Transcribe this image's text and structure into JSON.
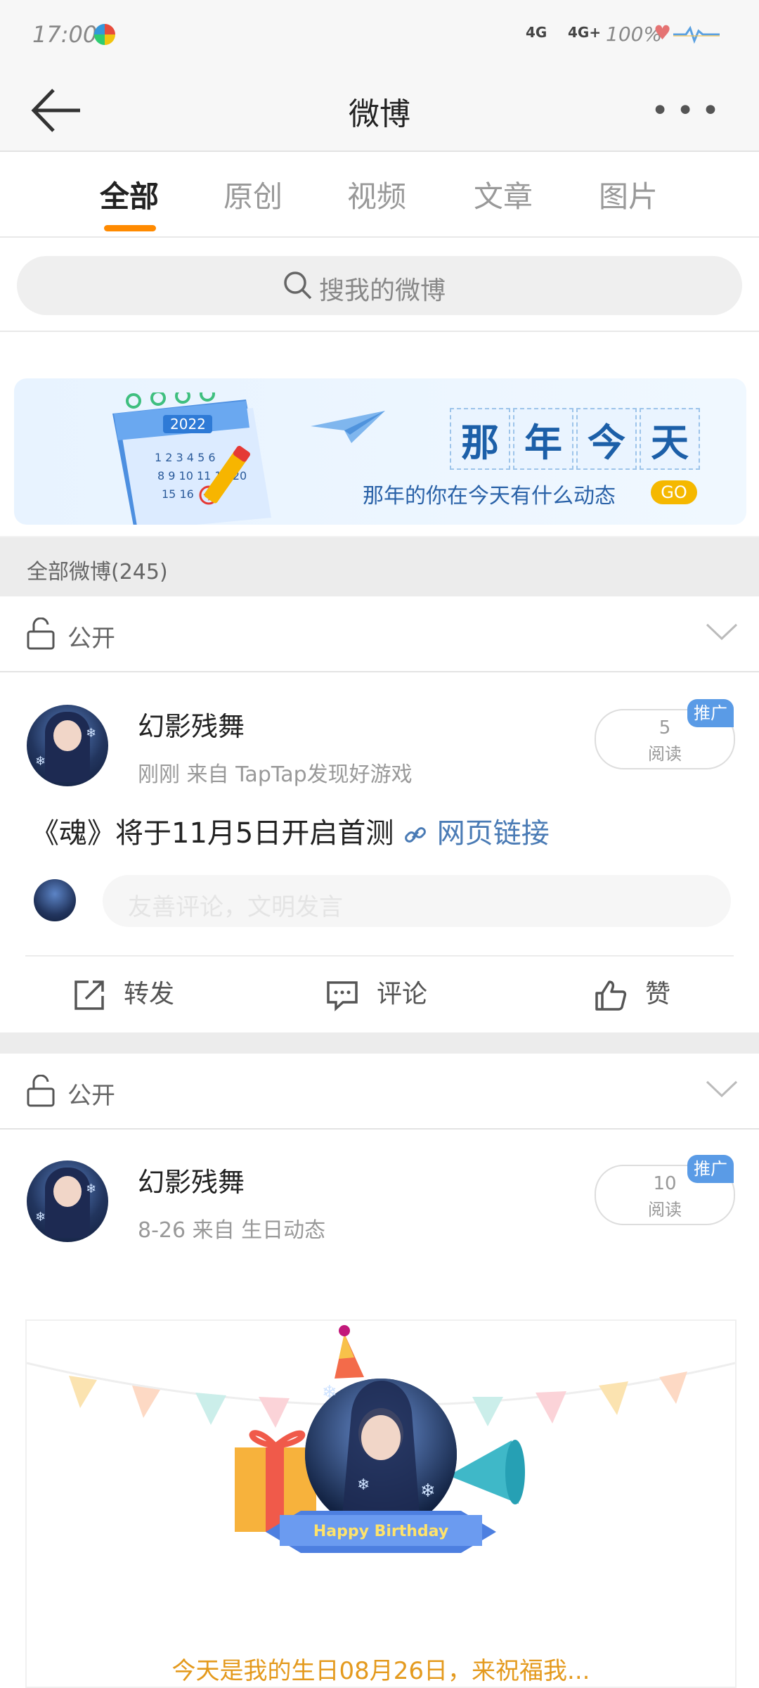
{
  "status_bar": {
    "time": "17:00",
    "signal1": "4G",
    "signal2": "4G+",
    "battery": "100%"
  },
  "header": {
    "title": "微博"
  },
  "tabs": [
    {
      "label": "全部",
      "active": true
    },
    {
      "label": "原创",
      "active": false
    },
    {
      "label": "视频",
      "active": false
    },
    {
      "label": "文章",
      "active": false
    },
    {
      "label": "图片",
      "active": false
    }
  ],
  "search": {
    "placeholder": "搜我的微博"
  },
  "banner": {
    "calendar_year": "2022",
    "calendar_today": "今",
    "title_chars": [
      "那",
      "年",
      "今",
      "天"
    ],
    "subtitle": "那年的你在今天有什么动态",
    "go": "GO"
  },
  "count_bar": {
    "label": "全部微博(245)"
  },
  "posts": [
    {
      "visibility": "公开",
      "username": "幻影残舞",
      "meta": "刚刚  来自  TapTap发现好游戏",
      "reads": "5",
      "reads_label": "阅读",
      "promo": "推广",
      "content": "《魂》将于11月5日开启首测",
      "link_text": "网页链接",
      "comment_placeholder": "友善评论，文明发言",
      "actions": {
        "repost": "转发",
        "comment": "评论",
        "like": "赞"
      }
    },
    {
      "visibility": "公开",
      "username": "幻影残舞",
      "meta": "8-26  来自  生日动态",
      "reads": "10",
      "reads_label": "阅读",
      "promo": "推广",
      "card_badge": "Happy Birthday",
      "card_text": "今天是我的生日08月26日，来祝福我..."
    }
  ],
  "colors": {
    "accent": "#ff8a00",
    "promo": "#5a9be6",
    "link": "#4a7bb5",
    "birthday_text": "#e49a1e"
  }
}
